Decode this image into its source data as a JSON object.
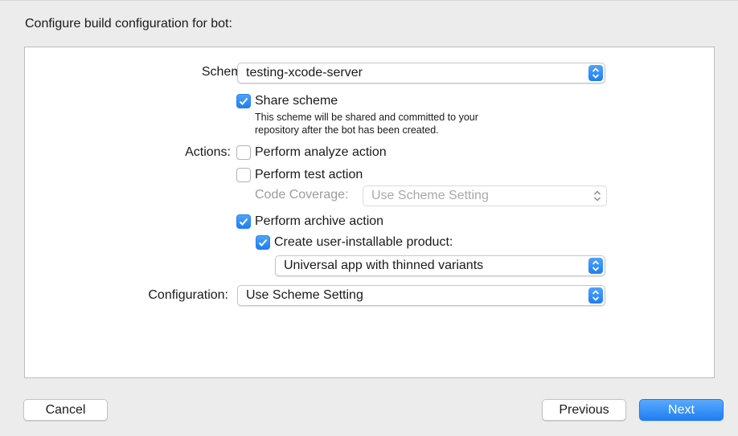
{
  "heading": "Configure build configuration for bot:",
  "scheme": {
    "label": "Scheme:",
    "value": "testing-xcode-server",
    "share": {
      "checked": true,
      "label": "Share scheme",
      "help_line1": "This scheme will be shared and committed to your",
      "help_line2": "repository after the bot has been created."
    }
  },
  "actions": {
    "label": "Actions:",
    "analyze": {
      "checked": false,
      "label": "Perform analyze action"
    },
    "test": {
      "checked": false,
      "label": "Perform test action"
    },
    "coverage": {
      "label": "Code Coverage:",
      "value": "Use Scheme Setting",
      "enabled": false
    },
    "archive": {
      "checked": true,
      "label": "Perform archive action"
    },
    "installable": {
      "checked": true,
      "label": "Create user-installable product:"
    },
    "product_type": {
      "value": "Universal app with thinned variants"
    }
  },
  "configuration": {
    "label": "Configuration:",
    "value": "Use Scheme Setting"
  },
  "buttons": {
    "cancel": "Cancel",
    "previous": "Previous",
    "next": "Next"
  },
  "colors": {
    "accent": "#1e7ef2",
    "panel_bg": "#ffffff",
    "window_bg": "#ececec"
  }
}
